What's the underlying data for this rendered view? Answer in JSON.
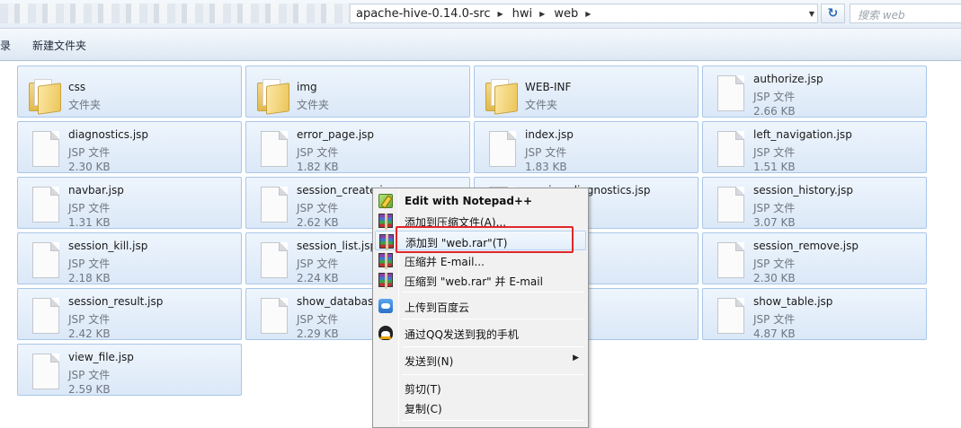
{
  "address": {
    "crumbs": [
      "apache-hive-0.14.0-src",
      "hwi",
      "web"
    ],
    "search_placeholder": "搜索 web"
  },
  "toolbar": {
    "left_partial": "录",
    "new_folder": "新建文件夹"
  },
  "files": [
    {
      "name": "css",
      "type": "文件夹",
      "size": "",
      "kind": "folder"
    },
    {
      "name": "img",
      "type": "文件夹",
      "size": "",
      "kind": "folder"
    },
    {
      "name": "WEB-INF",
      "type": "文件夹",
      "size": "",
      "kind": "folder"
    },
    {
      "name": "authorize.jsp",
      "type": "JSP 文件",
      "size": "2.66 KB",
      "kind": "file"
    },
    {
      "name": "diagnostics.jsp",
      "type": "JSP 文件",
      "size": "2.30 KB",
      "kind": "file"
    },
    {
      "name": "error_page.jsp",
      "type": "JSP 文件",
      "size": "1.82 KB",
      "kind": "file"
    },
    {
      "name": "index.jsp",
      "type": "JSP 文件",
      "size": "1.83 KB",
      "kind": "file"
    },
    {
      "name": "left_navigation.jsp",
      "type": "JSP 文件",
      "size": "1.51 KB",
      "kind": "file"
    },
    {
      "name": "navbar.jsp",
      "type": "JSP 文件",
      "size": "1.31 KB",
      "kind": "file"
    },
    {
      "name": "session_create.jsp",
      "type": "JSP 文件",
      "size": "2.62 KB",
      "kind": "file"
    },
    {
      "name": "session_diagnostics.jsp",
      "type": "JSP 文件",
      "size": "",
      "kind": "file"
    },
    {
      "name": "session_history.jsp",
      "type": "JSP 文件",
      "size": "3.07 KB",
      "kind": "file"
    },
    {
      "name": "session_kill.jsp",
      "type": "JSP 文件",
      "size": "2.18 KB",
      "kind": "file"
    },
    {
      "name": "session_list.jsp",
      "type": "JSP 文件",
      "size": "2.24 KB",
      "kind": "file"
    },
    {
      "name": "session_manage.jsp",
      "type": "",
      "size": "",
      "kind": "file"
    },
    {
      "name": "session_remove.jsp",
      "type": "JSP 文件",
      "size": "2.30 KB",
      "kind": "file"
    },
    {
      "name": "session_result.jsp",
      "type": "JSP 文件",
      "size": "2.42 KB",
      "kind": "file"
    },
    {
      "name": "show_databases.jsp",
      "type": "JSP 文件",
      "size": "2.29 KB",
      "kind": "file"
    },
    {
      "name": "show_databases.jsp",
      "type": "",
      "size": "",
      "kind": "file"
    },
    {
      "name": "show_table.jsp",
      "type": "JSP 文件",
      "size": "4.87 KB",
      "kind": "file"
    },
    {
      "name": "view_file.jsp",
      "type": "JSP 文件",
      "size": "2.59 KB",
      "kind": "file"
    }
  ],
  "file_display": [
    {
      "name": "css",
      "type": "文件夹",
      "size": ""
    },
    {
      "name": "img",
      "type": "文件夹",
      "size": ""
    },
    {
      "name": "WEB-INF",
      "type": "文件夹",
      "size": ""
    },
    {
      "name": "authorize.jsp",
      "type": "JSP 文件",
      "size": "2.66 KB"
    },
    {
      "name": "diagnostics.jsp",
      "type": "JSP 文件",
      "size": "2.30 KB"
    },
    {
      "name": "error_page.jsp",
      "type": "JSP 文件",
      "size": "1.82 KB"
    },
    {
      "name": "index.jsp",
      "type": "JSP 文件",
      "size": "1.83 KB"
    },
    {
      "name": "left_navigation.jsp",
      "type": "JSP 文件",
      "size": "1.51 KB"
    },
    {
      "name": "navbar.jsp",
      "type": "JSP 文件",
      "size": "1.31 KB"
    },
    {
      "name": "session_create.jsp",
      "type": "JSP 文件",
      "size": "2.62 KB"
    },
    {
      "name": "session_diagnostics.jsp",
      "type": "",
      "size": ""
    },
    {
      "name": "session_history.jsp",
      "type": "JSP 文件",
      "size": "3.07 KB"
    },
    {
      "name": "session_kill.jsp",
      "type": "JSP 文件",
      "size": "2.18 KB"
    },
    {
      "name": "session_list.jsp",
      "type": "JSP 文件",
      "size": "2.24 KB"
    },
    {
      "name": "nage.jsp",
      "type": "",
      "size": ""
    },
    {
      "name": "session_remove.jsp",
      "type": "JSP 文件",
      "size": "2.30 KB"
    },
    {
      "name": "session_result.jsp",
      "type": "JSP 文件",
      "size": "2.42 KB"
    },
    {
      "name": "show_databas",
      "type": "JSP 文件",
      "size": "2.29 KB"
    },
    {
      "name": "ases.jsp",
      "type": "",
      "size": ""
    },
    {
      "name": "show_table.jsp",
      "type": "JSP 文件",
      "size": "4.87 KB"
    },
    {
      "name": "view_file.jsp",
      "type": "JSP 文件",
      "size": "2.59 KB"
    }
  ],
  "context_menu": {
    "items": [
      {
        "label": "Edit with Notepad++",
        "icon": "notepad-plus-plus-icon",
        "bold": true
      },
      {
        "label": "添加到压缩文件(A)...",
        "icon": "winrar-icon"
      },
      {
        "label": "添加到 \"web.rar\"(T)",
        "icon": "winrar-icon",
        "highlighted": true
      },
      {
        "label": "压缩并 E-mail...",
        "icon": "winrar-icon"
      },
      {
        "label": "压缩到 \"web.rar\" 并 E-mail",
        "icon": "winrar-icon"
      },
      {
        "label": "上传到百度云",
        "icon": "baidu-cloud-icon"
      },
      {
        "label": "通过QQ发送到我的手机",
        "icon": "qq-icon"
      },
      {
        "label": "发送到(N)",
        "icon": "",
        "submenu": true
      },
      {
        "label": "剪切(T)",
        "icon": ""
      },
      {
        "label": "复制(C)",
        "icon": ""
      }
    ]
  },
  "colors": {
    "tile_border": "#a9c7ea",
    "tile_bg": "#dbe8f7",
    "highlight_box": "#e0262b"
  }
}
